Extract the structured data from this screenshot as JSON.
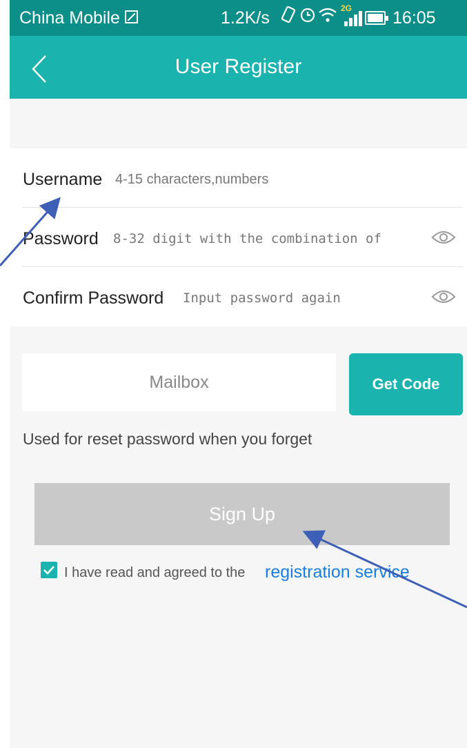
{
  "status_bar": {
    "carrier": "China Mobile",
    "speed": "1.2K/s",
    "network": "2G",
    "time": "16:05"
  },
  "header": {
    "title": "User Register",
    "back_icon": "chevron-left-icon"
  },
  "form": {
    "username": {
      "label": "Username",
      "placeholder": "4-15 characters,numbers"
    },
    "password": {
      "label": "Password",
      "placeholder": "8-32 digit with the combination of",
      "toggle_icon": "eye-icon"
    },
    "confirm_password": {
      "label": "Confirm Password",
      "placeholder": "Input password again",
      "toggle_icon": "eye-icon"
    }
  },
  "mailbox": {
    "placeholder": "Mailbox",
    "get_code_label": "Get Code",
    "hint": "Used for reset password when you forget"
  },
  "signup": {
    "label": "Sign Up"
  },
  "agreement": {
    "checked": true,
    "text": "I have read and agreed to the",
    "link_text": "registration service"
  },
  "colors": {
    "status_bar": "#0b8f88",
    "title_bar": "#1ab3ad",
    "accent": "#1ab3ad",
    "disabled_button": "#c9c9c9",
    "link": "#1a7de0",
    "annotation_arrow": "#3d5fb5"
  }
}
